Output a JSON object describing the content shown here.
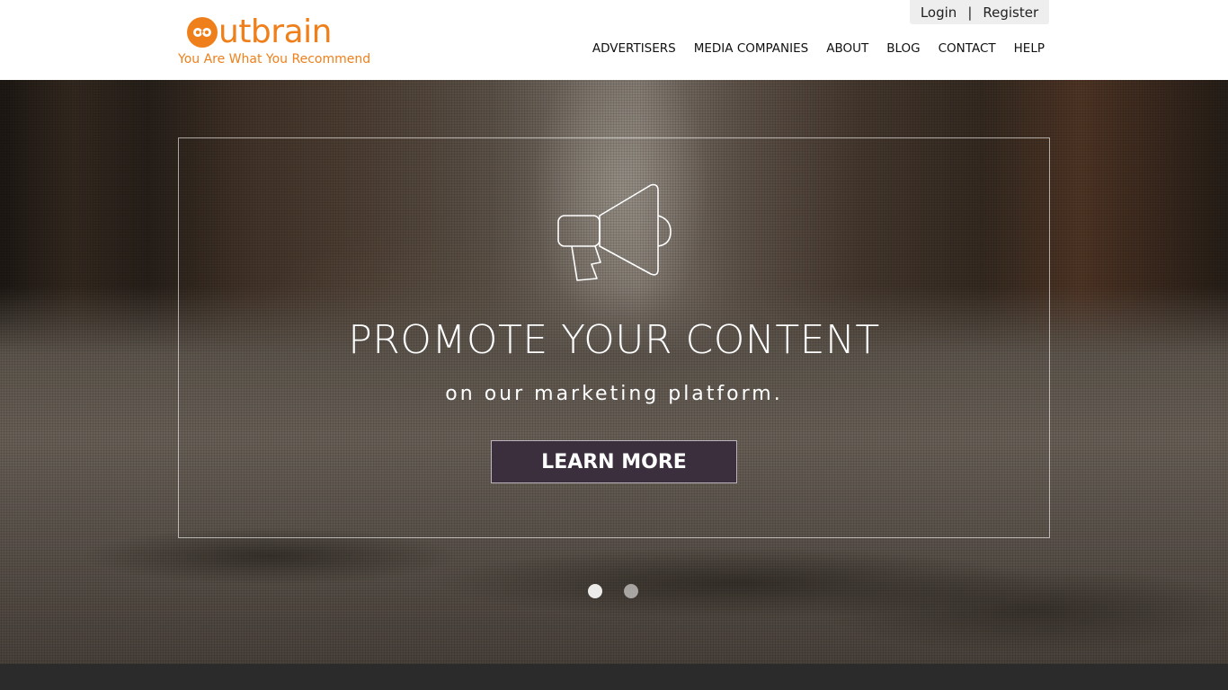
{
  "brand": {
    "name": "utbrain",
    "tagline": "You Are What You Recommend",
    "color": "#ef7f1a"
  },
  "auth": {
    "login": "Login",
    "separator": "|",
    "register": "Register"
  },
  "nav": {
    "items": [
      "ADVERTISERS",
      "MEDIA COMPANIES",
      "ABOUT",
      "BLOG",
      "CONTACT",
      "HELP"
    ]
  },
  "hero": {
    "icon": "megaphone-icon",
    "title": "PROMOTE YOUR CONTENT",
    "subtitle": "on our marketing platform.",
    "cta": "LEARN MORE",
    "cta_color": "#3b2f3d",
    "slides": {
      "count": 2,
      "active": 1
    }
  }
}
